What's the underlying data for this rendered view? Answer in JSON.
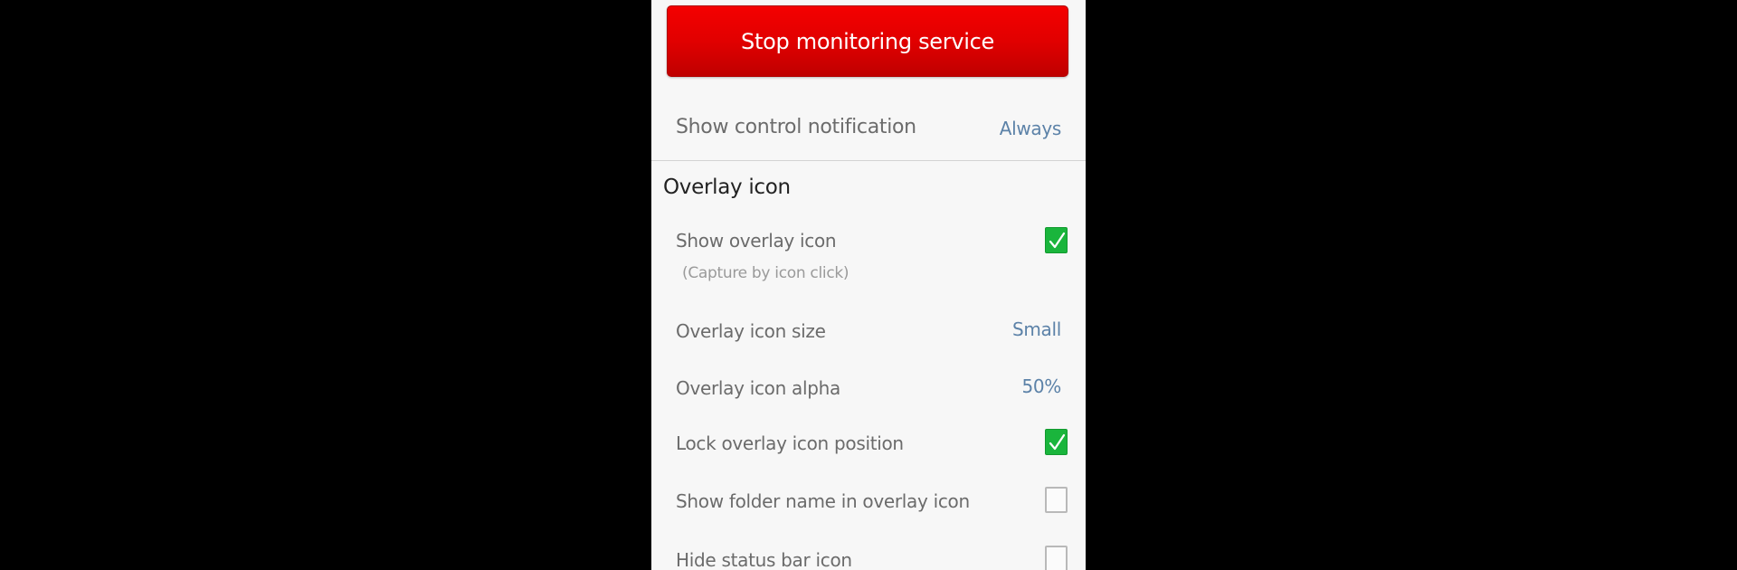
{
  "stop_button": {
    "label": "Stop monitoring service"
  },
  "control_notification": {
    "label": "Show control notification",
    "value": "Always"
  },
  "overlay_section": {
    "title": "Overlay icon",
    "show_overlay_icon": {
      "label": "Show overlay icon",
      "sublabel": "(Capture by icon click)",
      "checked": true
    },
    "overlay_icon_size": {
      "label": "Overlay icon size",
      "value": "Small"
    },
    "overlay_icon_alpha": {
      "label": "Overlay icon alpha",
      "value": "50%"
    },
    "lock_overlay_icon_position": {
      "label": "Lock overlay icon position",
      "checked": true
    },
    "show_folder_name": {
      "label": "Show folder name in overlay icon",
      "checked": false
    },
    "hide_status_bar_icon": {
      "label": "Hide status bar icon",
      "checked": false
    }
  },
  "colors": {
    "accent_red": "#e10000",
    "value_blue": "#5c82a8",
    "check_green": "#1ab53c",
    "background": "#f7f7f7"
  }
}
